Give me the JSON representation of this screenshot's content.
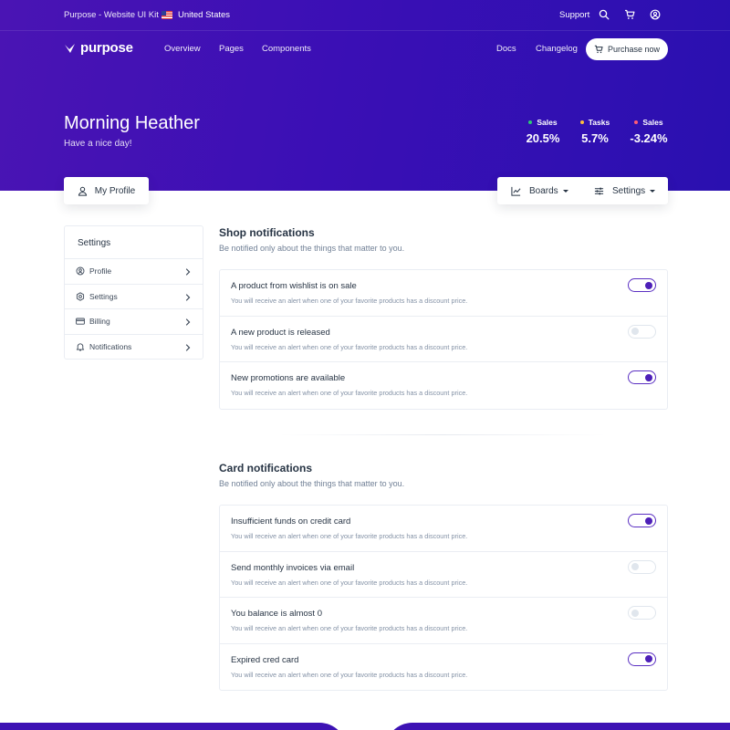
{
  "colors": {
    "primary": "#4a14b4",
    "toggle_on": "#4d1fb8",
    "dot_green": "#2dca73",
    "dot_orange": "#ffbe3d",
    "dot_red": "#ff5c75"
  },
  "topbar": {
    "brand": "Purpose - Website UI Kit",
    "country": "United States",
    "support": "Support",
    "icons": [
      "flag-icon",
      "search-icon",
      "cart-icon",
      "user-circle-icon"
    ]
  },
  "navbar": {
    "logo": "purpose",
    "links": [
      "Overview",
      "Pages",
      "Components"
    ],
    "docs": "Docs",
    "changelog": "Changelog",
    "purchase": "Purchase now"
  },
  "hero": {
    "name": "Morning Heather",
    "greeting": "Have a nice day!",
    "stats": [
      {
        "label": "Sales",
        "value": "20.5%",
        "dot": "green"
      },
      {
        "label": "Tasks",
        "value": "5.7%",
        "dot": "orange"
      },
      {
        "label": "Sales",
        "value": "-3.24%",
        "dot": "red"
      }
    ]
  },
  "actions": {
    "my_profile": "My Profile",
    "boards": "Boards",
    "settings": "Settings"
  },
  "sidebar": {
    "title": "Settings",
    "items": [
      {
        "label": "Profile",
        "icon": "user-circle-icon"
      },
      {
        "label": "Settings",
        "icon": "gear-icon"
      },
      {
        "label": "Billing",
        "icon": "credit-card-icon"
      },
      {
        "label": "Notifications",
        "icon": "bell-icon"
      }
    ]
  },
  "shop": {
    "title": "Shop notifications",
    "subtitle": "Be notified only about the things that matter to you.",
    "rows": [
      {
        "title": "A product from wishlist is on sale",
        "desc": "You will receive an alert when one of your favorite products has a discount price.",
        "on": true
      },
      {
        "title": "A new product is released",
        "desc": "You will receive an alert when one of your favorite products has a discount price.",
        "on": false
      },
      {
        "title": "New promotions are available",
        "desc": "You will receive an alert when one of your favorite products has a discount price.",
        "on": true
      }
    ]
  },
  "card": {
    "title": "Card notifications",
    "subtitle": "Be notified only about the things that matter to you.",
    "rows": [
      {
        "title": "Insufficient funds on credit card",
        "desc": "You will receive an alert when one of your favorite products has a discount price.",
        "on": true
      },
      {
        "title": "Send monthly invoices via email",
        "desc": "You will receive an alert when one of your favorite products has a discount price.",
        "on": false
      },
      {
        "title": "You balance is almost 0",
        "desc": "You will receive an alert when one of your favorite products has a discount price.",
        "on": false
      },
      {
        "title": "Expired cred card",
        "desc": "You will receive an alert when one of your favorite products has a discount price.",
        "on": true
      }
    ]
  }
}
